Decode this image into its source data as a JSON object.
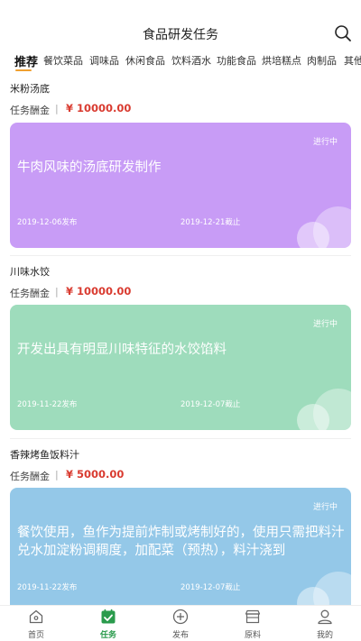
{
  "header": {
    "title": "食品研发任务",
    "search_icon": "search-icon"
  },
  "tabs": [
    {
      "label": "推荐",
      "active": true
    },
    {
      "label": "餐饮菜品"
    },
    {
      "label": "调味品"
    },
    {
      "label": "休闲食品"
    },
    {
      "label": "饮料酒水"
    },
    {
      "label": "功能食品"
    },
    {
      "label": "烘培糕点"
    },
    {
      "label": "肉制品"
    },
    {
      "label": "其他"
    }
  ],
  "tasks": [
    {
      "name": "米粉汤底",
      "reward_label": "任务酬金",
      "reward": "¥ 10000.00",
      "status": "进行中",
      "description": "牛肉风味的汤底研发制作",
      "published": "2019-12-06发布",
      "deadline": "2019-12-21截止",
      "color": "#c89cf6"
    },
    {
      "name": "川味水饺",
      "reward_label": "任务酬金",
      "reward": "¥ 10000.00",
      "status": "进行中",
      "description": "开发出具有明显川味特征的水饺馅料",
      "published": "2019-11-22发布",
      "deadline": "2019-12-07截止",
      "color": "#9edcbc"
    },
    {
      "name": "香辣烤鱼饭料汁",
      "reward_label": "任务酬金",
      "reward": "¥ 5000.00",
      "status": "进行中",
      "description": "餐饮使用，鱼作为提前炸制或烤制好的，使用只需把料汁兑水加淀粉调稠度，加配菜（预热），料汁浇到",
      "published": "2019-11-22发布",
      "deadline": "2019-12-07截止",
      "color": "#94c8e8"
    }
  ],
  "tabbar": [
    {
      "label": "首页",
      "icon": "home-icon"
    },
    {
      "label": "任务",
      "icon": "task-calendar-icon",
      "active": true
    },
    {
      "label": "发布",
      "icon": "plus-circle-icon"
    },
    {
      "label": "原料",
      "icon": "shop-icon"
    },
    {
      "label": "我的",
      "icon": "user-icon"
    }
  ],
  "colors": {
    "accent": "#2a9b4c",
    "reward": "#d93b30",
    "tab_underline": "#f0a030"
  }
}
